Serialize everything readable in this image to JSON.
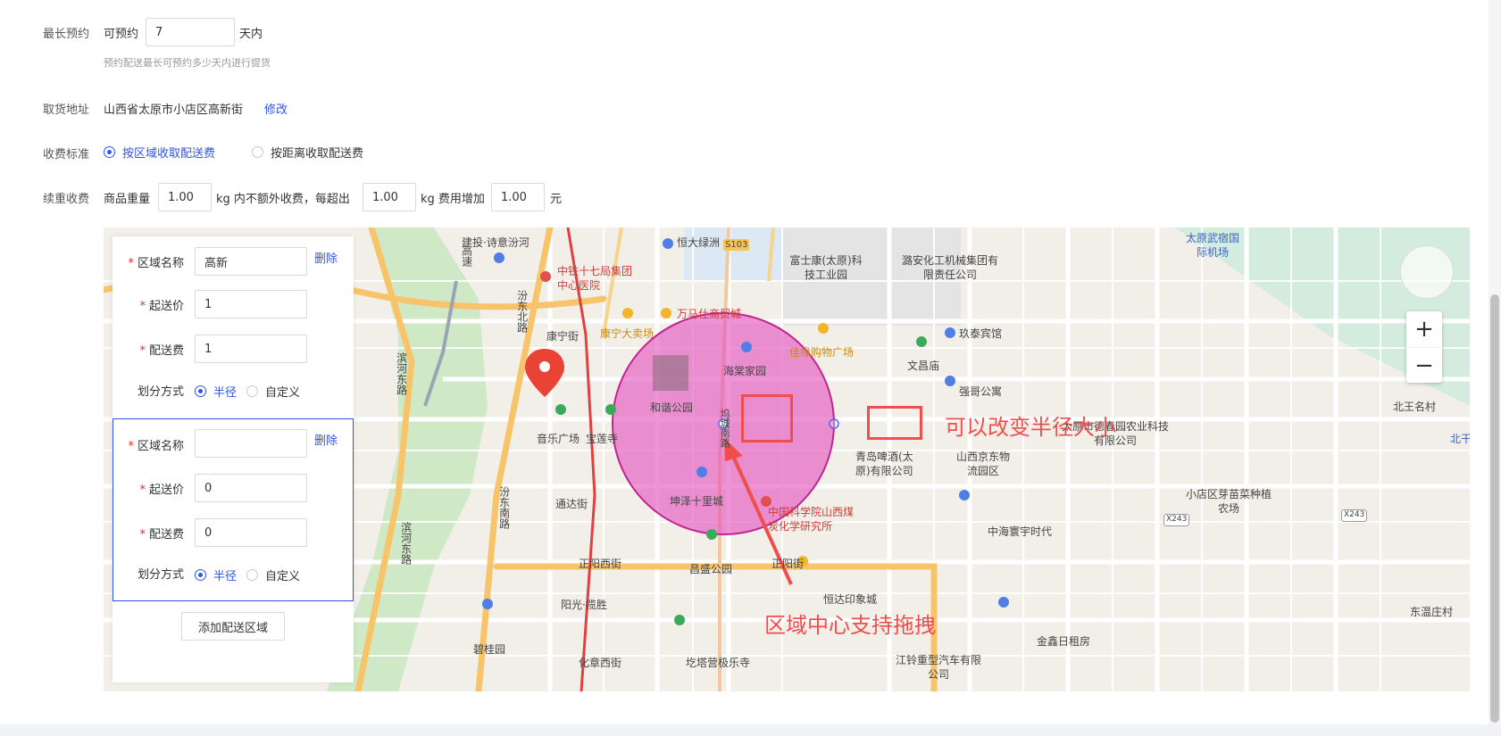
{
  "max_booking": {
    "label": "最长预约",
    "prefix": "可预约",
    "value": "7",
    "suffix": "天内",
    "hint": "预约配送最长可预约多少天内进行提货"
  },
  "pickup_address": {
    "label": "取货地址",
    "value": "山西省太原市小店区高新街",
    "edit_link": "修改"
  },
  "fee_standard": {
    "label": "收费标准",
    "options": [
      {
        "label": "按区域收取配送费",
        "checked": true
      },
      {
        "label": "按距离收取配送费",
        "checked": false
      }
    ]
  },
  "extra_weight": {
    "label": "续重收费",
    "part1": "商品重量",
    "weight": "1.00",
    "part2": "kg 内不额外收费，每超出",
    "every": "1.00",
    "part3": "kg 费用增加",
    "fee": "1.00",
    "unit": "元"
  },
  "zones": [
    {
      "name_label": "区域名称",
      "name_value": "高新",
      "name_placeholder": "",
      "delete": "删除",
      "min_price_label": "起送价",
      "min_price": "1",
      "fee_label": "配送费",
      "fee": "1",
      "method_label": "划分方式",
      "methods": [
        {
          "label": "半径",
          "checked": true
        },
        {
          "label": "自定义",
          "checked": false
        }
      ]
    },
    {
      "name_label": "区域名称",
      "name_value": "",
      "name_placeholder": "",
      "delete": "删除",
      "min_price_label": "起送价",
      "min_price": "0",
      "fee_label": "配送费",
      "fee": "0",
      "method_label": "划分方式",
      "methods": [
        {
          "label": "半径",
          "checked": true
        },
        {
          "label": "自定义",
          "checked": false
        }
      ]
    }
  ],
  "add_zone_button": "添加配送区域",
  "map": {
    "zoom_in": "+",
    "zoom_out": "−",
    "labels": [
      "建投·诗意汾河",
      "恒大绿洲",
      "S103",
      "富士康(太原)科技工业园",
      "潞安化工机械集团有限责任公司",
      "太原武宿国际机场",
      "中铁十七局集团中心医院",
      "万马仕商贸城",
      "康宁街",
      "康宁大卖场",
      "汾东北路",
      "佳缘购物广场",
      "玖泰宾馆",
      "海棠家园",
      "文昌庙",
      "滨河东路",
      "强哥公寓",
      "和谐公园",
      "北王名村",
      "太原市德春园农业科技有限公司",
      "北干",
      "音乐广场",
      "宝莲寺",
      "青岛啤酒(太原)有限公司",
      "山西京东物流园区",
      "坤泽十里城",
      "通达街",
      "小店区芽苗菜种植农场",
      "X243",
      "X243",
      "中国科学院山西煤炭化学研究所",
      "中海寰宇时代",
      "汾东南路",
      "滨河东路",
      "正阳西街",
      "昌盛公园",
      "正阳街",
      "阳光·揽胜",
      "恒达印象城",
      "东温庄村",
      "碧桂园",
      "金鑫日租房",
      "化章西街",
      "圪塔营极乐寺",
      "江铃重型汽车有限公司",
      "高速",
      "坞城南路"
    ],
    "annotation_radius": "可以改变半径大小",
    "annotation_center": "区域中心支持拖拽"
  }
}
